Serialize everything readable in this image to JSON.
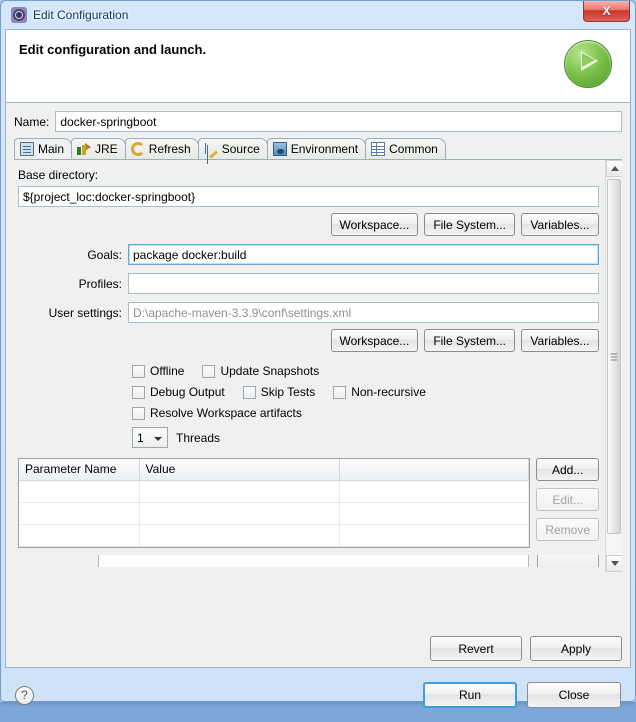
{
  "window": {
    "title": "Edit Configuration",
    "title_icon": "gear-icon",
    "close_label": "X"
  },
  "header": {
    "title": "Edit configuration and launch.",
    "badge_icon": "run-play-icon"
  },
  "name_field": {
    "label": "Name:",
    "value": "docker-springboot"
  },
  "tabs": [
    {
      "label": "Main",
      "icon": "clipboard-icon",
      "active": true
    },
    {
      "label": "JRE",
      "icon": "books-icon",
      "active": false
    },
    {
      "label": "Refresh",
      "icon": "refresh-swirl-icon",
      "active": false
    },
    {
      "label": "Source",
      "icon": "source-tree-icon",
      "active": false
    },
    {
      "label": "Environment",
      "icon": "environment-monitor-icon",
      "active": false
    },
    {
      "label": "Common",
      "icon": "common-table-icon",
      "active": false
    }
  ],
  "main_tab": {
    "base_directory": {
      "label": "Base directory:",
      "value": "${project_loc:docker-springboot}"
    },
    "browse_buttons_top": [
      {
        "label": "Workspace..."
      },
      {
        "label": "File System..."
      },
      {
        "label": "Variables..."
      }
    ],
    "fields": [
      {
        "label": "Goals:",
        "value": "package docker:build",
        "placeholder": "",
        "focused": true,
        "muted": false
      },
      {
        "label": "Profiles:",
        "value": "",
        "placeholder": "",
        "focused": false,
        "muted": false
      },
      {
        "label": "User settings:",
        "value": "D:\\apache-maven-3.3.9\\conf\\settings.xml",
        "placeholder": "",
        "focused": false,
        "muted": true
      }
    ],
    "browse_buttons_bottom": [
      {
        "label": "Workspace..."
      },
      {
        "label": "File System..."
      },
      {
        "label": "Variables..."
      }
    ],
    "checkbox_rows": [
      [
        {
          "label": "Offline",
          "checked": false
        },
        {
          "label": "Update Snapshots",
          "checked": false
        }
      ],
      [
        {
          "label": "Debug Output",
          "checked": false
        },
        {
          "label": "Skip Tests",
          "checked": false
        },
        {
          "label": "Non-recursive",
          "checked": false
        }
      ],
      [
        {
          "label": "Resolve Workspace artifacts",
          "checked": false
        }
      ]
    ],
    "threads": {
      "value": "1",
      "label": "Threads"
    },
    "parameter_table": {
      "columns": [
        "Parameter Name",
        "Value",
        ""
      ],
      "rows": [],
      "empty_row_count": 3,
      "buttons": [
        {
          "label": "Add...",
          "enabled": true
        },
        {
          "label": "Edit...",
          "enabled": false
        },
        {
          "label": "Remove",
          "enabled": false
        }
      ]
    }
  },
  "apply_bar": {
    "revert_label": "Revert",
    "apply_label": "Apply"
  },
  "footer": {
    "help_icon": "question-mark-icon",
    "help_label": "?",
    "run_label": "Run",
    "close_label": "Close"
  },
  "colors": {
    "window_border": "#6f9dd0",
    "titlebar": "#c3dcf5",
    "close_red": "#c9352b",
    "panel_bg": "#f0f0ee",
    "run_green": "#7cc24c",
    "focus_blue": "#3c9fdc"
  }
}
